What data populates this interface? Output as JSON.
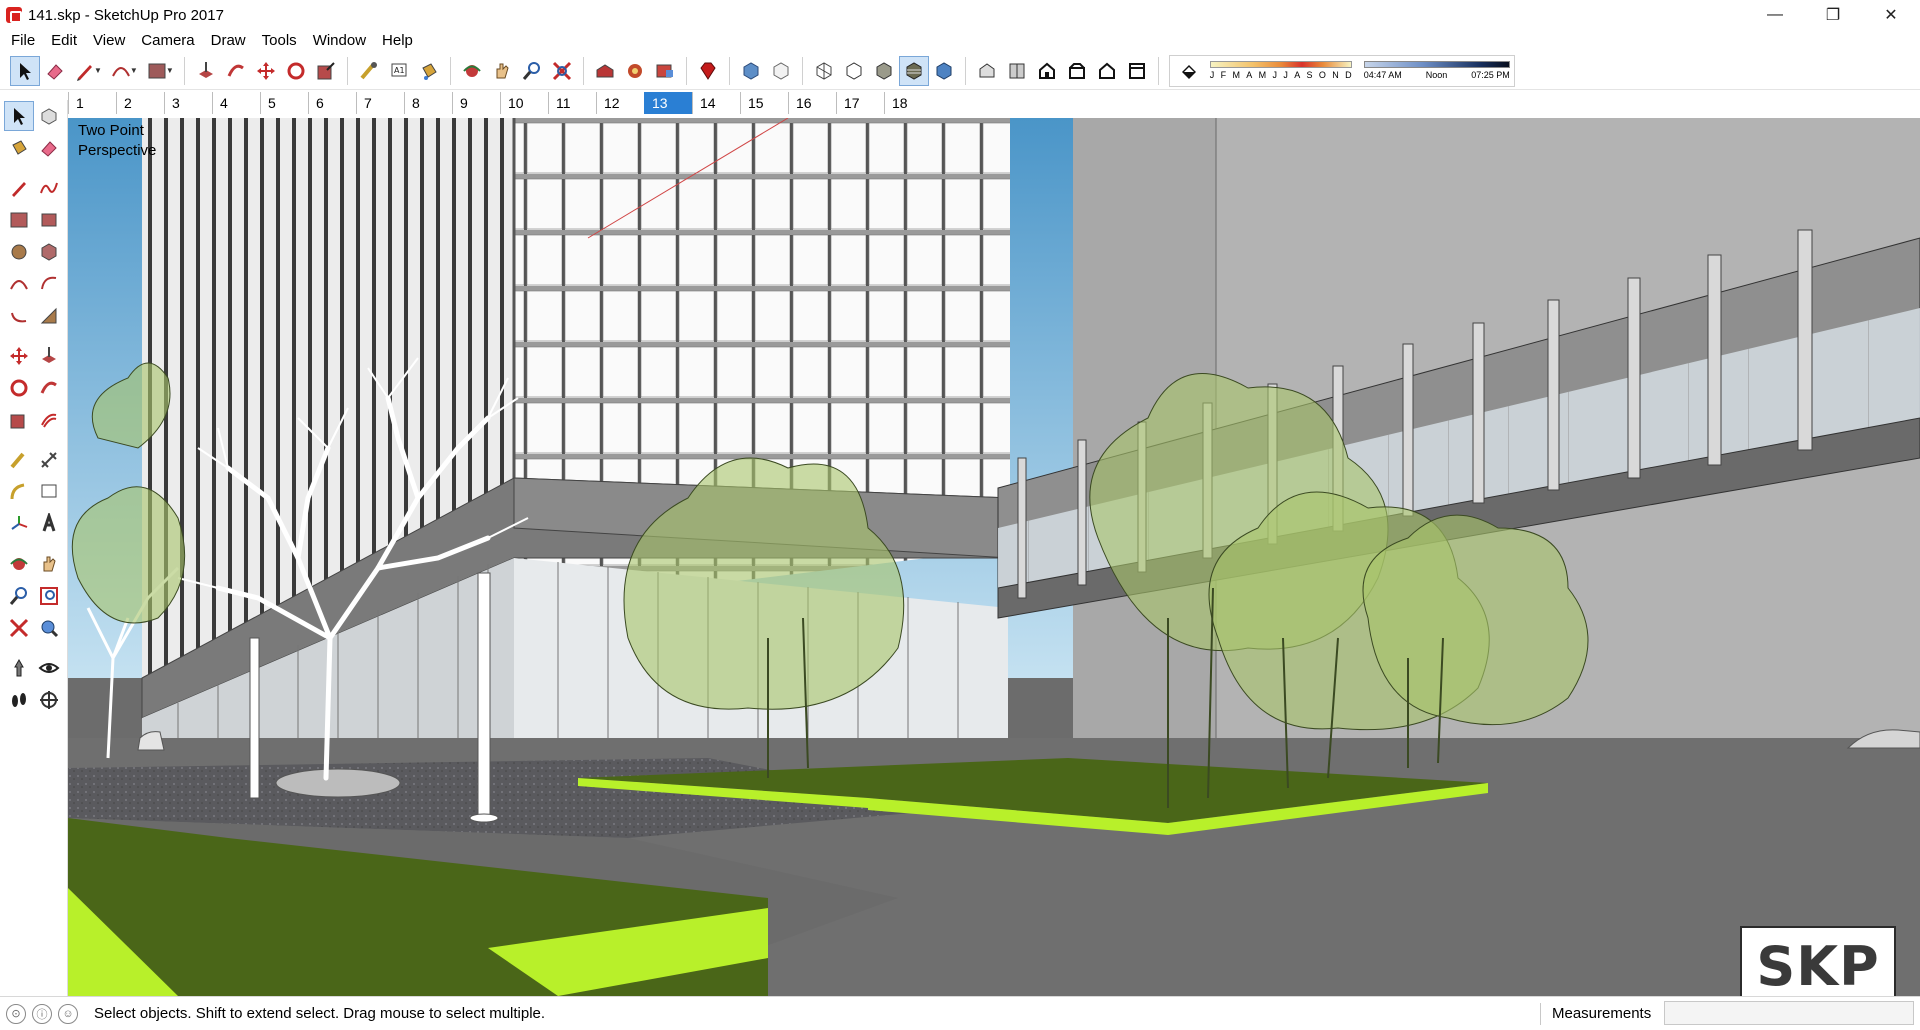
{
  "window": {
    "title": "141.skp - SketchUp Pro 2017",
    "minimize": "—",
    "maximize": "❐",
    "close": "✕"
  },
  "menu": [
    "File",
    "Edit",
    "View",
    "Camera",
    "Draw",
    "Tools",
    "Window",
    "Help"
  ],
  "toolbar": {
    "shadow_months": [
      "J",
      "F",
      "M",
      "A",
      "M",
      "J",
      "J",
      "A",
      "S",
      "O",
      "N",
      "D"
    ],
    "time_start": "04:47 AM",
    "time_mid": "Noon",
    "time_end": "07:25 PM"
  },
  "scenes": {
    "tabs": [
      "1",
      "2",
      "3",
      "4",
      "5",
      "6",
      "7",
      "8",
      "9",
      "10",
      "11",
      "12",
      "13",
      "14",
      "15",
      "16",
      "17",
      "18"
    ],
    "active_index": 12
  },
  "viewport": {
    "camera_label_line1": "Two Point",
    "camera_label_line2": "Perspective",
    "watermark": "SKP"
  },
  "status": {
    "message": "Select objects. Shift to extend select. Drag mouse to select multiple.",
    "measurements_label": "Measurements",
    "measurements_value": ""
  },
  "colors": {
    "sky": "#7fb9dd",
    "grass_dark": "#4a6618",
    "grass_edge": "#b8f02a",
    "pavement": "#6f6f6f",
    "tree_green": "#a9c46a",
    "accent_active": "#2a7fd4"
  }
}
